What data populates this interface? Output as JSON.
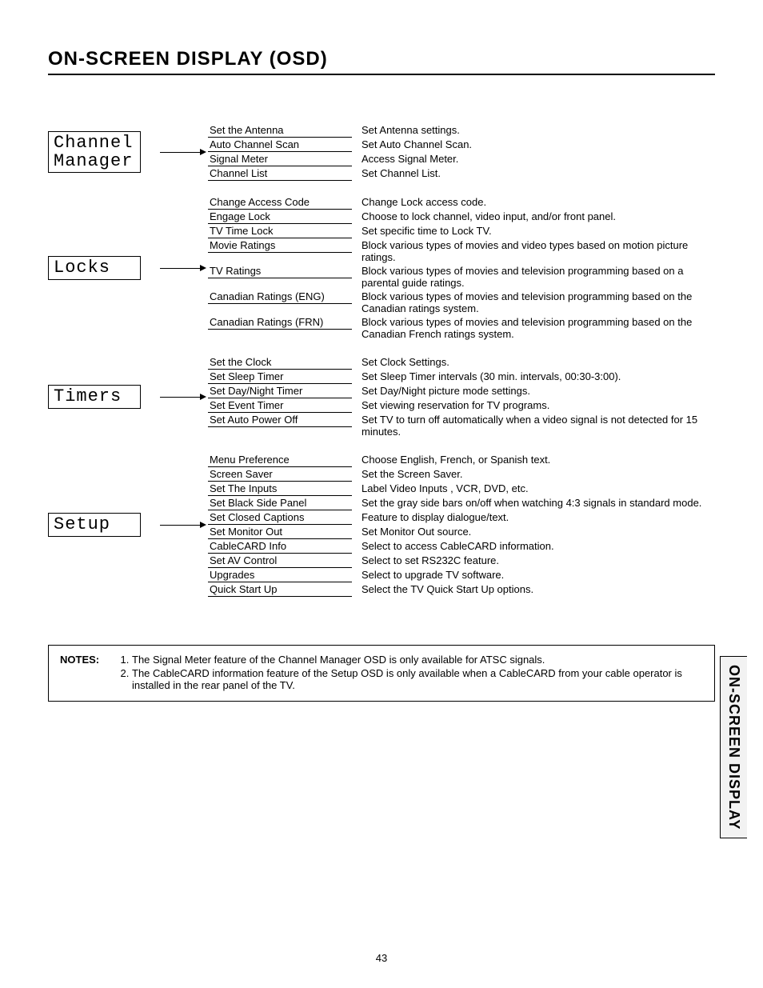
{
  "title": "ON-SCREEN DISPLAY (OSD)",
  "sideTab": "ON-SCREEN DISPLAY",
  "pageNumber": "43",
  "sections": [
    {
      "label": "Channel\nManager",
      "items": [
        {
          "name": "Set the Antenna",
          "desc": "Set Antenna settings."
        },
        {
          "name": "Auto Channel Scan",
          "desc": "Set Auto Channel Scan."
        },
        {
          "name": "Signal Meter",
          "desc": "Access Signal Meter."
        },
        {
          "name": "Channel List",
          "desc": "Set Channel List."
        }
      ]
    },
    {
      "label": "Locks",
      "items": [
        {
          "name": "Change Access Code",
          "desc": "Change Lock access code."
        },
        {
          "name": "Engage Lock",
          "desc": "Choose to lock channel, video input, and/or front panel."
        },
        {
          "name": "TV Time Lock",
          "desc": "Set specific time to Lock TV."
        },
        {
          "name": "Movie Ratings",
          "desc": "Block various types of movies and video types based on motion picture ratings."
        },
        {
          "name": "TV Ratings",
          "desc": "Block various types of movies and television programming based on a parental guide ratings."
        },
        {
          "name": "Canadian Ratings (ENG)",
          "desc": "Block various types of movies and television programming based on the Canadian ratings system."
        },
        {
          "name": "Canadian Ratings (FRN)",
          "desc": "Block various types of movies and television programming based on the Canadian French ratings system."
        }
      ]
    },
    {
      "label": "Timers",
      "items": [
        {
          "name": "Set the Clock",
          "desc": "Set Clock Settings."
        },
        {
          "name": "Set Sleep Timer",
          "desc": "Set Sleep Timer intervals (30 min. intervals, 00:30-3:00)."
        },
        {
          "name": "Set Day/Night Timer",
          "desc": "Set Day/Night picture mode settings."
        },
        {
          "name": "Set Event Timer",
          "desc": "Set viewing reservation for TV programs."
        },
        {
          "name": "Set Auto Power Off",
          "desc": "Set TV to turn off automatically when a video signal is not detected for 15 minutes."
        }
      ]
    },
    {
      "label": "Setup",
      "items": [
        {
          "name": "Menu Preference",
          "desc": "Choose English, French, or Spanish text."
        },
        {
          "name": "Screen Saver",
          "desc": "Set the Screen Saver."
        },
        {
          "name": "Set The Inputs",
          "desc": "Label Video Inputs , VCR, DVD, etc."
        },
        {
          "name": "Set Black Side Panel",
          "desc": "Set the gray side bars on/off when watching 4:3 signals in standard mode."
        },
        {
          "name": "Set Closed Captions",
          "desc": "Feature to display dialogue/text."
        },
        {
          "name": "Set Monitor Out",
          "desc": "Set Monitor Out source."
        },
        {
          "name": "CableCARD Info",
          "desc": "Select to access CableCARD information."
        },
        {
          "name": "Set AV Control",
          "desc": "Select to set RS232C feature."
        },
        {
          "name": "Upgrades",
          "desc": "Select to upgrade TV software."
        },
        {
          "name": "Quick Start Up",
          "desc": "Select the TV Quick Start Up options."
        }
      ]
    }
  ],
  "notes": {
    "label": "NOTES:",
    "items": [
      "The Signal Meter feature of the Channel Manager OSD is only available for ATSC signals.",
      "The CableCARD information feature of the Setup OSD is only available when a CableCARD from your cable operator is installed in the rear panel of the TV."
    ]
  }
}
